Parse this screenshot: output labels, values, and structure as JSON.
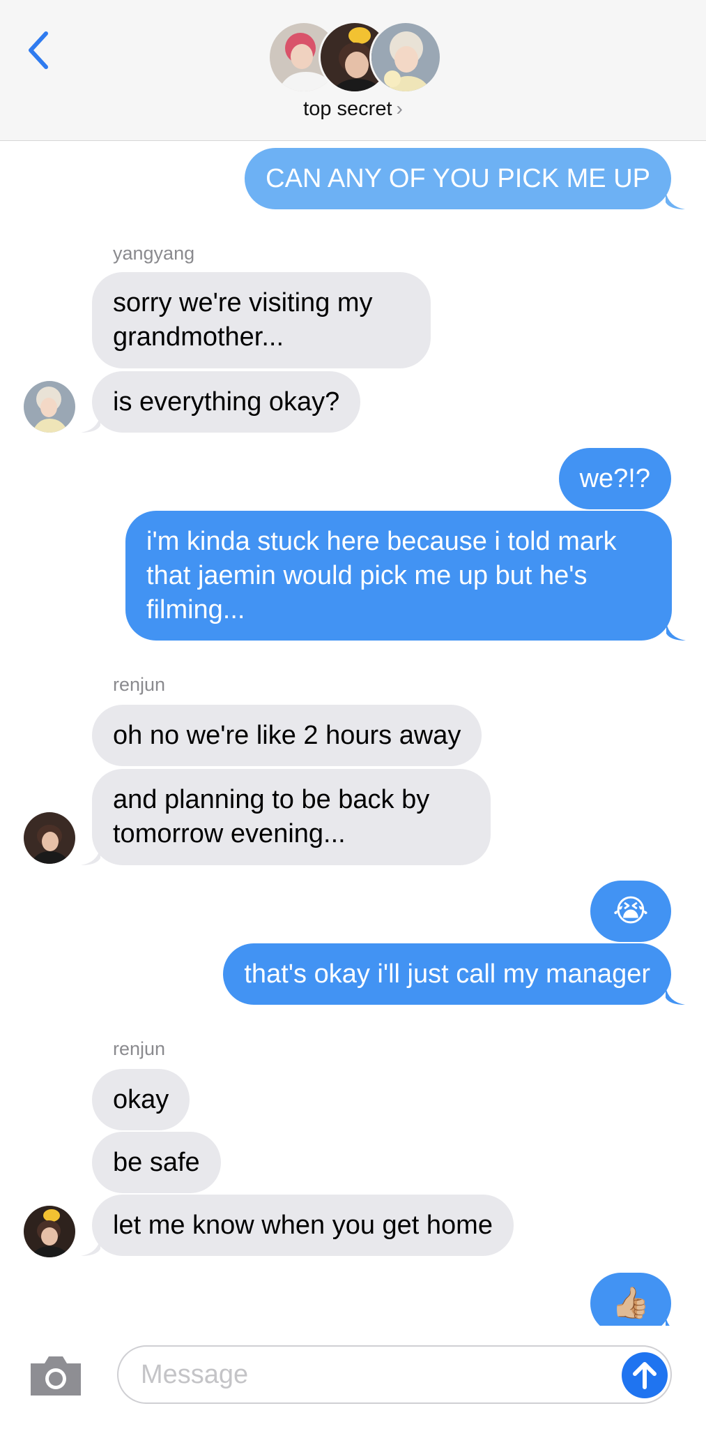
{
  "header": {
    "group_name": "top secret",
    "chevron": "›"
  },
  "messages": [
    {
      "id": "m1",
      "direction": "out",
      "text": "CAN ANY OF YOU PICK ME UP"
    },
    {
      "id": "s1",
      "sender": "yangyang"
    },
    {
      "id": "m2",
      "direction": "in",
      "text": "sorry we're visiting my grandmother..."
    },
    {
      "id": "m3",
      "direction": "in",
      "text": "is everything okay?"
    },
    {
      "id": "m4",
      "direction": "out",
      "text": "we?!?"
    },
    {
      "id": "m5",
      "direction": "out",
      "text": "i'm kinda stuck here because i told mark that jaemin would pick me up but he's filming..."
    },
    {
      "id": "s2",
      "sender": "renjun"
    },
    {
      "id": "m6",
      "direction": "in",
      "text": "oh no we're like 2 hours away"
    },
    {
      "id": "m7",
      "direction": "in",
      "text": "and planning to be back by tomorrow evening..."
    },
    {
      "id": "m8",
      "direction": "out",
      "text": "😭"
    },
    {
      "id": "m9",
      "direction": "out",
      "text": "that's okay i'll just call my manager"
    },
    {
      "id": "s3",
      "sender": "renjun"
    },
    {
      "id": "m10",
      "direction": "in",
      "text": "okay"
    },
    {
      "id": "m11",
      "direction": "in",
      "text": "be safe"
    },
    {
      "id": "m12",
      "direction": "in",
      "text": "let me know when you get home"
    },
    {
      "id": "m13",
      "direction": "out",
      "text": "👍🏼"
    }
  ],
  "input": {
    "placeholder": "Message"
  },
  "icons": {
    "back": "chevron-left-icon",
    "camera": "camera-icon",
    "send": "arrow-up-icon"
  },
  "colors": {
    "outgoing_bubble": "#4293f3",
    "incoming_bubble": "#e8e8ec",
    "accent": "#1f74f0",
    "header_bg": "#f6f6f6"
  }
}
